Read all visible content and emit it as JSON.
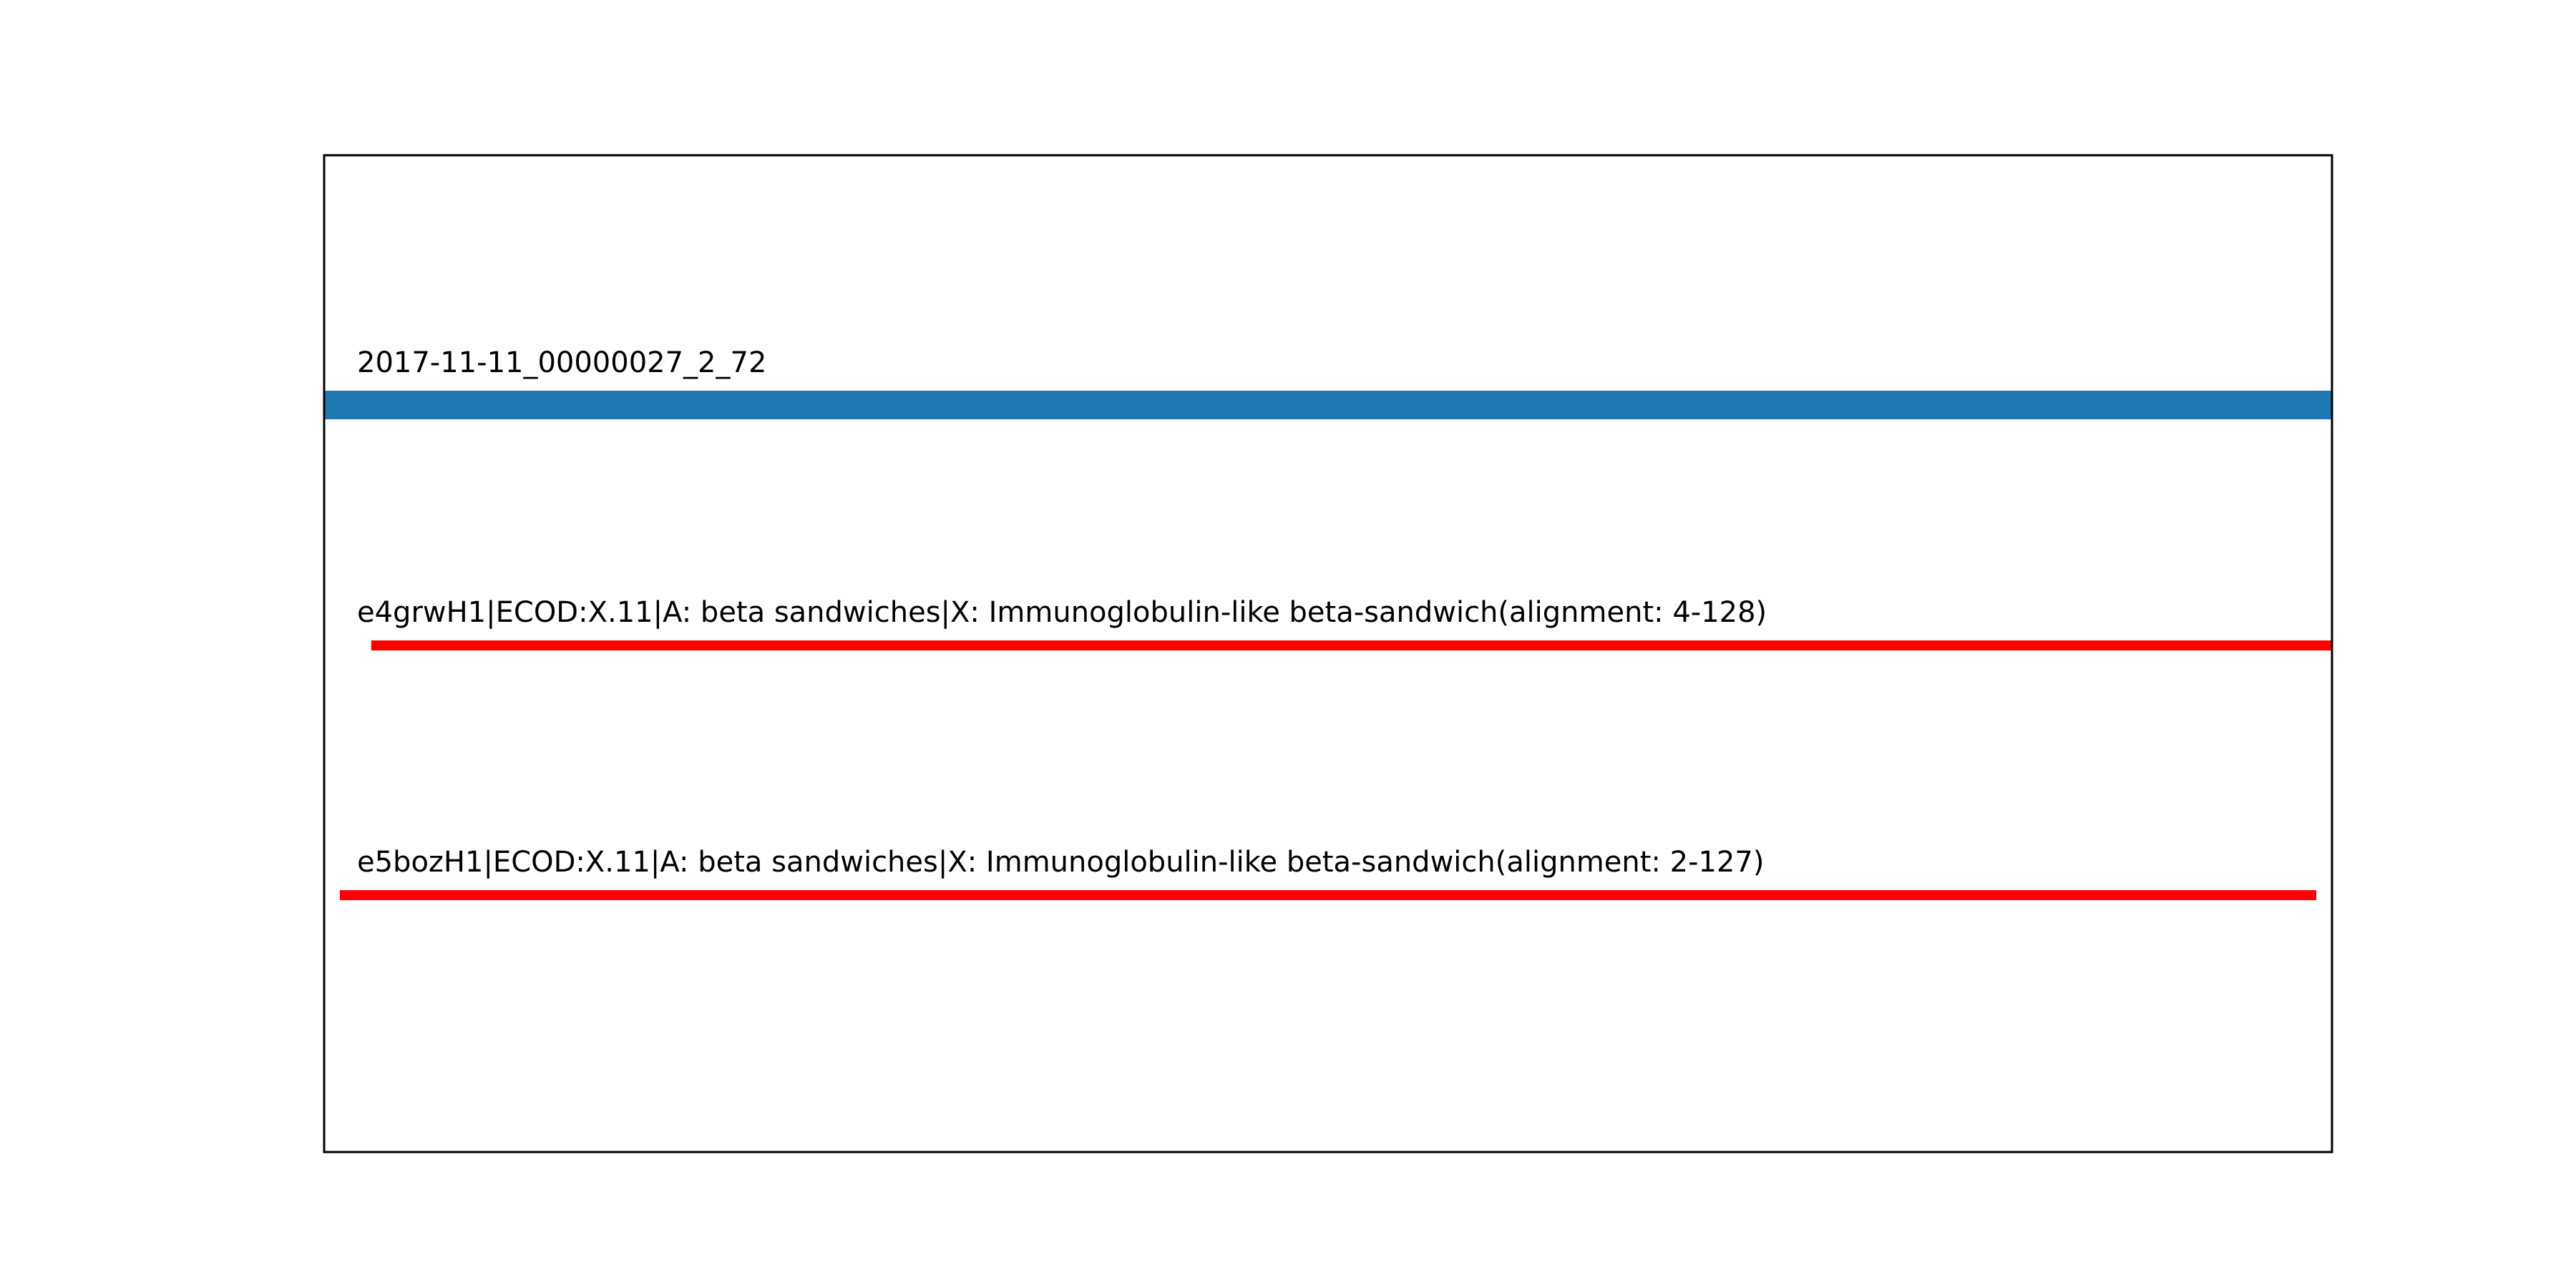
{
  "chart_data": {
    "type": "bar",
    "orientation": "horizontal",
    "xlim": [
      1,
      129
    ],
    "grid": false,
    "legend": "none",
    "series": [
      {
        "label": "2017-11-11_00000027_2_72",
        "start": 1,
        "end": 129,
        "color": "#1f77b4"
      },
      {
        "label": "e4grwH1|ECOD:X.11|A: beta sandwiches|X: Immunoglobulin-like beta-sandwich(alignment: 4-128)",
        "start": 4,
        "end": 129,
        "color": "#ff0000"
      },
      {
        "label": "e5bozH1|ECOD:X.11|A: beta sandwiches|X: Immunoglobulin-like beta-sandwich(alignment: 2-127)",
        "start": 2,
        "end": 128,
        "color": "#ff0000"
      }
    ]
  }
}
